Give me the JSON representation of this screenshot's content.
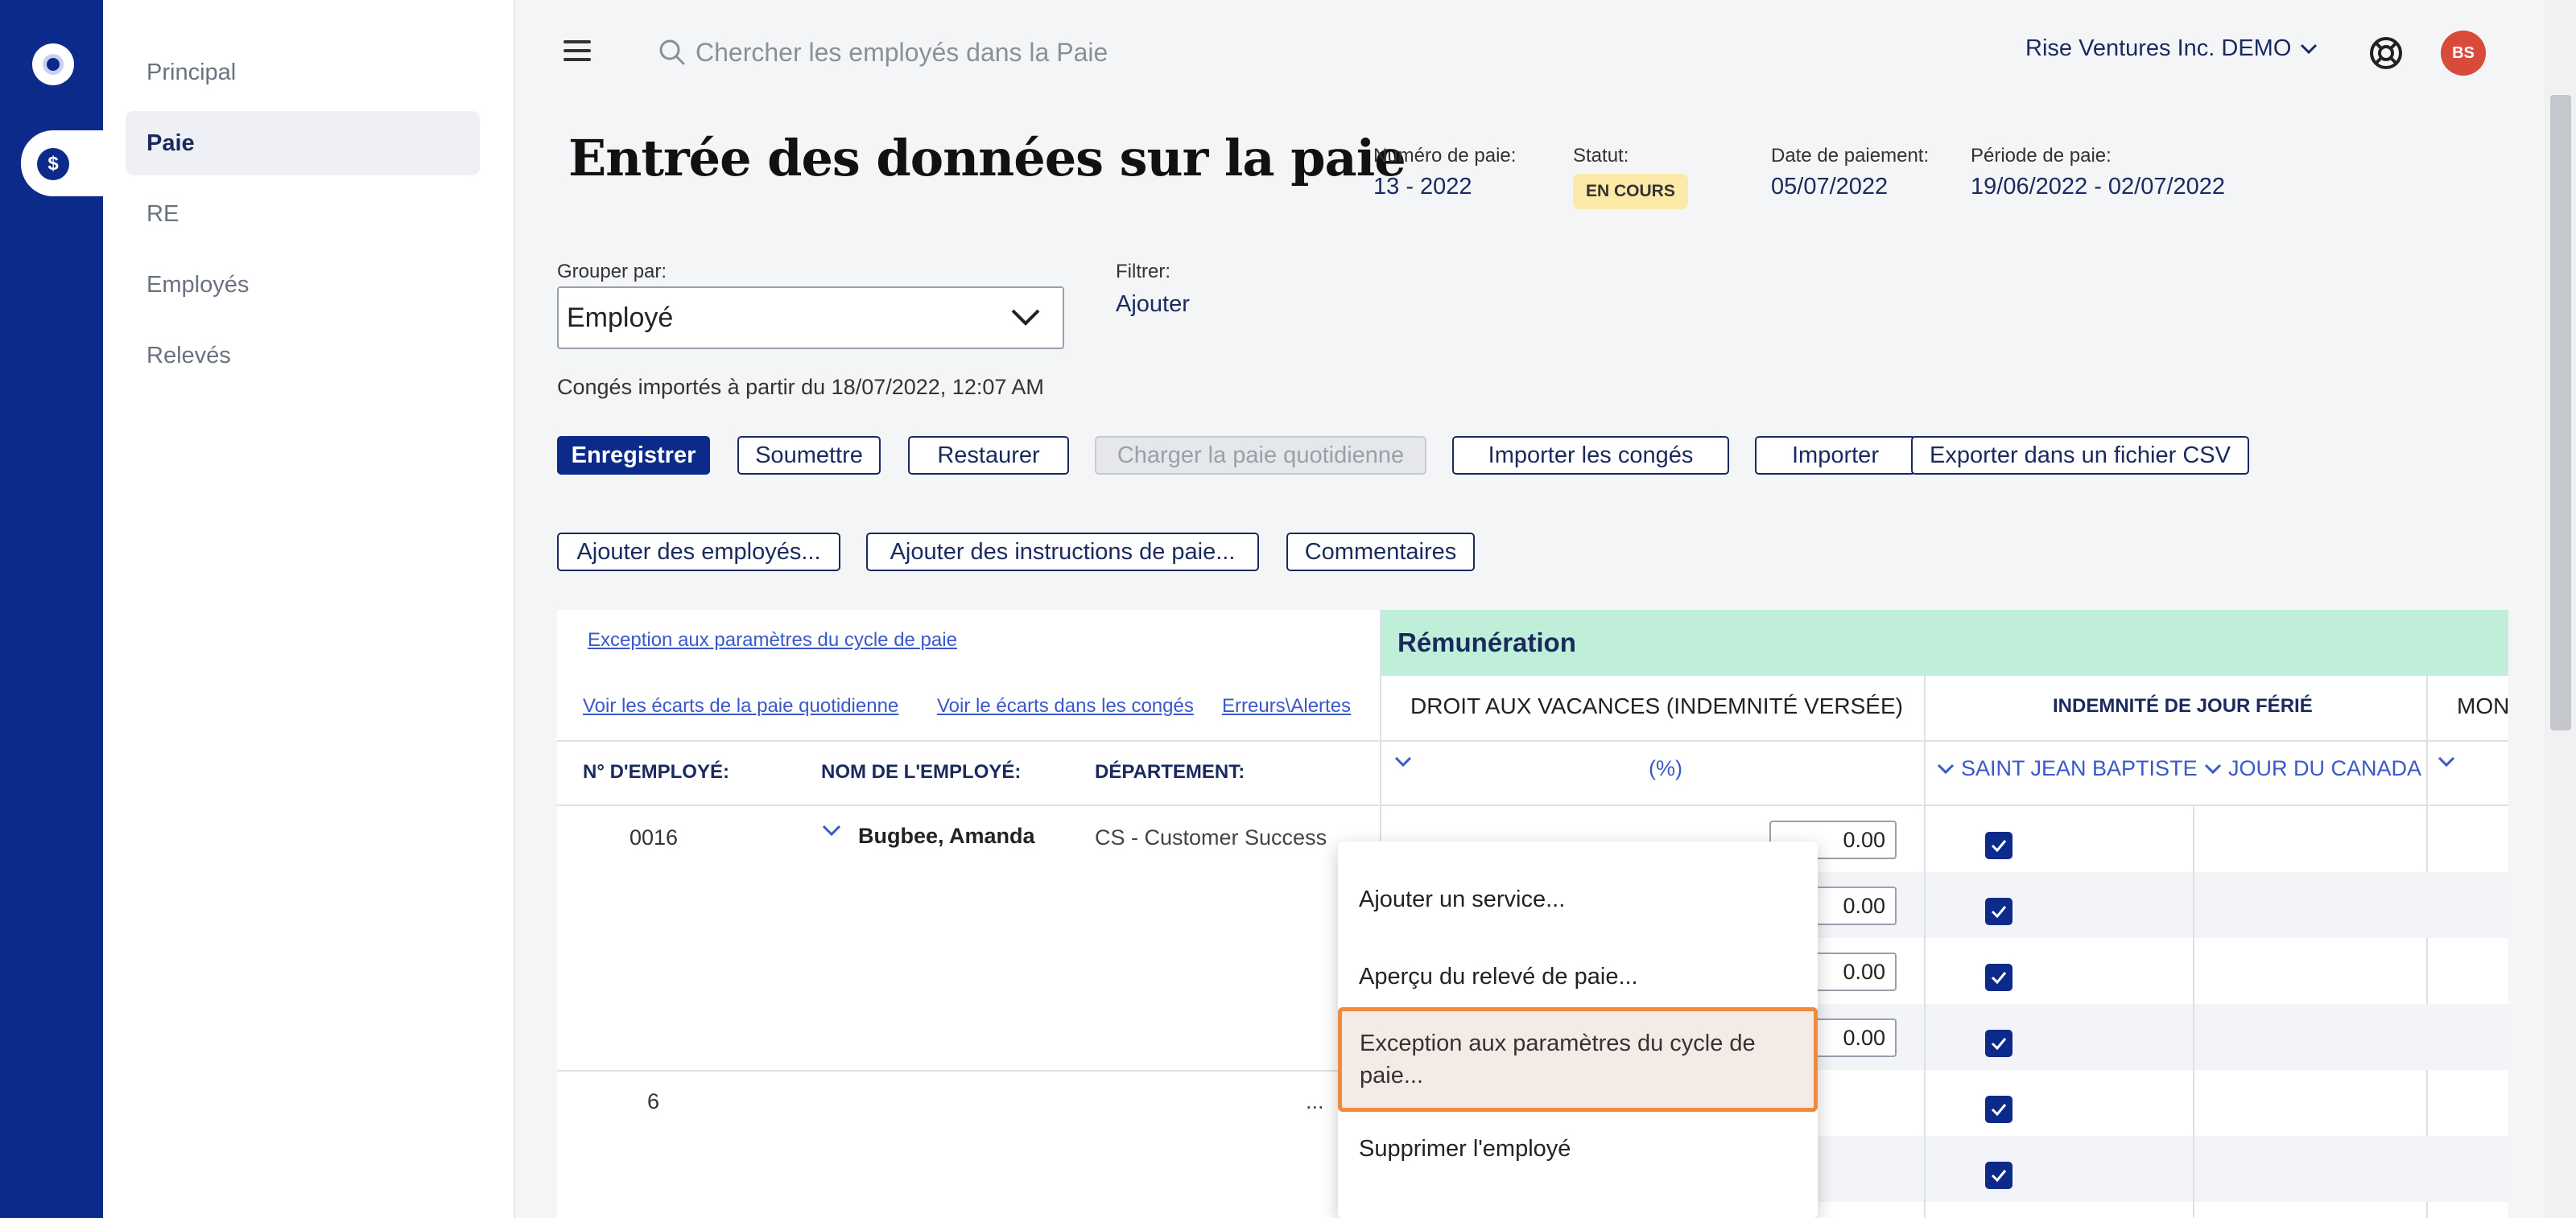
{
  "nav": {
    "items": [
      {
        "label": "Principal"
      },
      {
        "label": "Paie"
      },
      {
        "label": "RE"
      },
      {
        "label": "Employés"
      },
      {
        "label": "Relevés"
      }
    ]
  },
  "topbar": {
    "search_placeholder": "Chercher les employés dans la Paie",
    "company": "Rise Ventures Inc. DEMO",
    "avatar_initials": "BS"
  },
  "header": {
    "title": "Entrée des données sur la paie",
    "pay_number_label": "Numéro de paie:",
    "pay_number": "13 - 2022",
    "status_label": "Statut:",
    "status": "EN COURS",
    "pay_date_label": "Date de paiement:",
    "pay_date": "05/07/2022",
    "period_label": "Période de paie:",
    "period": "19/06/2022 - 02/07/2022"
  },
  "controls": {
    "group_label": "Grouper par:",
    "group_value": "Employé",
    "filter_label": "Filtrer:",
    "filter_add": "Ajouter",
    "conges_info": "Congés importés à partir du 18/07/2022, 12:07 AM"
  },
  "toolbar": {
    "save": "Enregistrer",
    "submit": "Soumettre",
    "restore": "Restaurer",
    "load_daily": "Charger la paie quotidienne",
    "import_leave": "Importer les congés",
    "import": "Importer",
    "export_csv": "Exporter dans un fichier CSV",
    "add_employees": "Ajouter des employés...",
    "add_instructions": "Ajouter des instructions de paie...",
    "comments": "Commentaires"
  },
  "table": {
    "link_exception": "Exception aux paramètres du cycle de paie",
    "link_daily_gaps": "Voir les écarts de la paie quotidienne",
    "link_leave_gaps": "Voir le écarts dans les congés",
    "link_errors": "Erreurs\\Alertes",
    "section": "Rémunération",
    "col_emp_no": "N° D'EMPLOYÉ:",
    "col_emp_name": "NOM DE L'EMPLOYÉ:",
    "col_dept": "DÉPARTEMENT:",
    "col_vacation": "DROIT AUX VACANCES (INDEMNITÉ VERSÉE)",
    "col_vacation_sub": "(%)",
    "col_holiday": "INDEMNITÉ DE JOUR FÉRIÉ",
    "col_holiday_sub1": "SAINT JEAN BAPTISTE",
    "col_holiday_sub2": "JOUR DU CANADA",
    "col_next": "MON",
    "rows": [
      {
        "emp_no": "0016",
        "name": "Bugbee, Amanda",
        "dept": "CS - Customer Success",
        "vac": "0.00"
      },
      {
        "vac": "0.00"
      },
      {
        "vac": "0.00"
      },
      {
        "vac": "0.00"
      },
      {
        "emp_no": "6",
        "dept_tail": "..."
      }
    ]
  },
  "menu": {
    "add_service": "Ajouter un service...",
    "preview": "Aperçu du relevé de paie...",
    "exception_line1": "Exception aux paramètres du cycle de",
    "exception_line2": "paie...",
    "delete": "Supprimer l'employé"
  }
}
